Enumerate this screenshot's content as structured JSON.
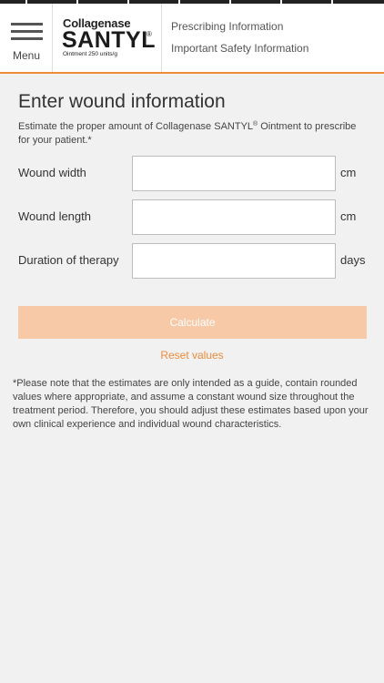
{
  "header": {
    "menu_label": "Menu",
    "brand_top": "Collagenase",
    "brand_main": "SANTYL",
    "brand_registered": "®",
    "brand_sub": "Ointment 250 units/g",
    "links": [
      "Prescribing Information",
      "Important Safety Information"
    ],
    "accent_color": "#ef8c3a"
  },
  "main": {
    "title": "Enter wound information",
    "intro_before": "Estimate the proper amount of Collagenase SANTYL",
    "intro_reg": "®",
    "intro_after": " Ointment to prescribe for your patient.*",
    "fields": [
      {
        "label": "Wound width",
        "value": "",
        "unit": "cm"
      },
      {
        "label": "Wound length",
        "value": "",
        "unit": "cm"
      },
      {
        "label": "Duration of therapy",
        "value": "",
        "unit": "days"
      }
    ],
    "calculate_label": "Calculate",
    "calculate_color": "#f8c9a6",
    "reset_label": "Reset values",
    "footnote": "*Please note that the estimates are only intended as a guide, contain rounded values where appropriate, and assume a constant wound size throughout the treatment period. Therefore, you should adjust these estimates based upon your own clinical experience and individual wound characteristics."
  }
}
